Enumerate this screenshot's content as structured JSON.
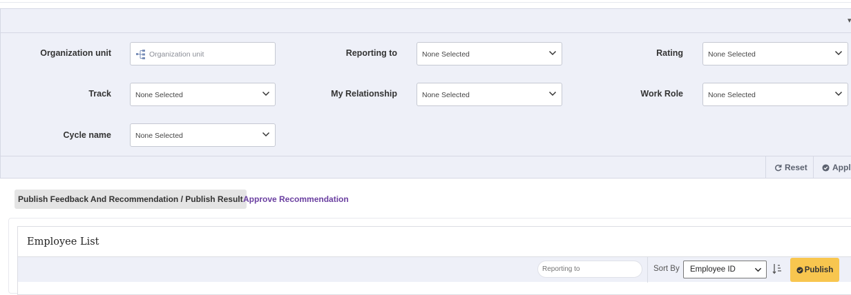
{
  "filters": {
    "organization_unit": {
      "label": "Organization unit",
      "placeholder": "Organization unit"
    },
    "reporting_to": {
      "label": "Reporting to",
      "value": "None Selected"
    },
    "rating": {
      "label": "Rating",
      "value": "None Selected"
    },
    "track": {
      "label": "Track",
      "value": "None Selected"
    },
    "my_relationship": {
      "label": "My Relationship",
      "value": "None Selected"
    },
    "work_role": {
      "label": "Work Role",
      "value": "None Selected"
    },
    "cycle_name": {
      "label": "Cycle name",
      "value": "None Selected"
    },
    "reset_label": "Reset",
    "apply_label": "Apply"
  },
  "tabs": [
    {
      "label": "Publish Feedback And Recommendation / Publish Result",
      "active": true
    },
    {
      "label": "Approve Recommendation",
      "active": false
    }
  ],
  "employee_list": {
    "title": "Employee List",
    "search_placeholder": "Reporting to",
    "sort_by_label": "Sort By",
    "sort_by_value": "Employee ID",
    "publish_label": "Publish"
  },
  "colors": {
    "panel_bg": "#eef0f8",
    "accent_purple": "#6a3fa0",
    "publish_yellow": "#f8c64f"
  }
}
